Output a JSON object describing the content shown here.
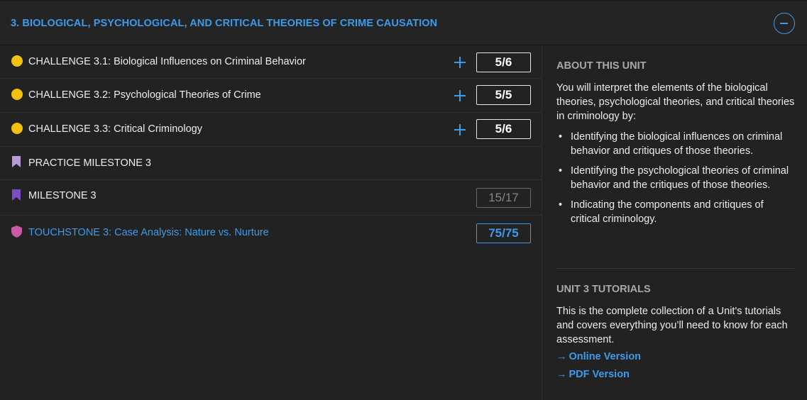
{
  "unit": {
    "title": "3. BIOLOGICAL, PSYCHOLOGICAL, AND CRITICAL THEORIES OF CRIME CAUSATION"
  },
  "items": [
    {
      "label": "CHALLENGE 3.1: Biological Influences on Criminal Behavior",
      "score": "5/6",
      "icon": "yellow-dot"
    },
    {
      "label": "CHALLENGE 3.2: Psychological Theories of Crime",
      "score": "5/5",
      "icon": "yellow-dot"
    },
    {
      "label": "CHALLENGE 3.3: Critical Criminology",
      "score": "5/6",
      "icon": "yellow-dot"
    },
    {
      "label": "PRACTICE MILESTONE 3",
      "score": "",
      "icon": "bookmark-icon"
    },
    {
      "label": "MILESTONE 3",
      "score": "15/17",
      "icon": "bookmark-icon"
    },
    {
      "label": "TOUCHSTONE 3: Case Analysis: Nature vs. Nurture",
      "score": "75/75",
      "icon": "shield-icon"
    }
  ],
  "about": {
    "heading": "ABOUT THIS UNIT",
    "intro": "You will interpret the elements of the biological theories, psychological theories, and critical theories in criminology by:",
    "bullets": [
      "Identifying the biological influences on criminal behavior and critiques of those theories.",
      "Identifying the psychological theories of criminal behavior and the critiques of those theories.",
      "Indicating the components and critiques of critical criminology."
    ]
  },
  "tutorials": {
    "heading": "UNIT 3 TUTORIALS",
    "description": "This is the complete collection of a Unit's tutorials and covers everything you’ll need to know for each assessment.",
    "online_label": "Online Version",
    "pdf_label": "PDF Version",
    "arrow": "→"
  },
  "colors": {
    "accent": "#3d9bea",
    "challenge_dot": "#f3c010",
    "practice_bookmark": "#b79ad6",
    "milestone_bookmark": "#7a4fc2",
    "touchstone_shield": "#c85aa6"
  }
}
